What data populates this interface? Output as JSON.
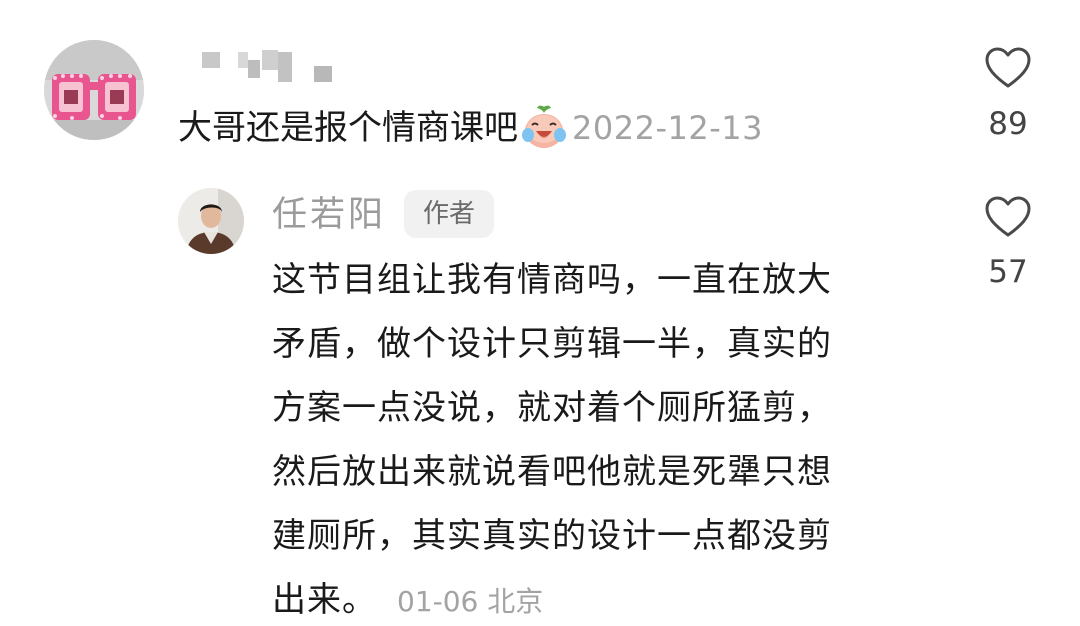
{
  "comment": {
    "text": "大哥还是报个情商课吧",
    "emoji": "crying-laughing-peach-emoji",
    "timestamp": "2022-12-13",
    "likes": "89"
  },
  "reply": {
    "username": "任若阳",
    "badge": "作者",
    "lines": [
      "这节目组让我有情商吗，一直在放大",
      "矛盾，做个设计只剪辑一半，真实的",
      "方案一点没说，就对着个厕所猛剪，",
      "然后放出来就说看吧他就是死犟只想",
      "建厕所，其实真实的设计一点都没剪",
      "出来。"
    ],
    "date": "01-06",
    "location": "北京",
    "likes": "57"
  },
  "icons": {
    "like": "heart-outline-icon"
  },
  "colors": {
    "text": "#1a1a1a",
    "muted": "#a3a3a3",
    "badge_bg": "#f1f1f1"
  }
}
